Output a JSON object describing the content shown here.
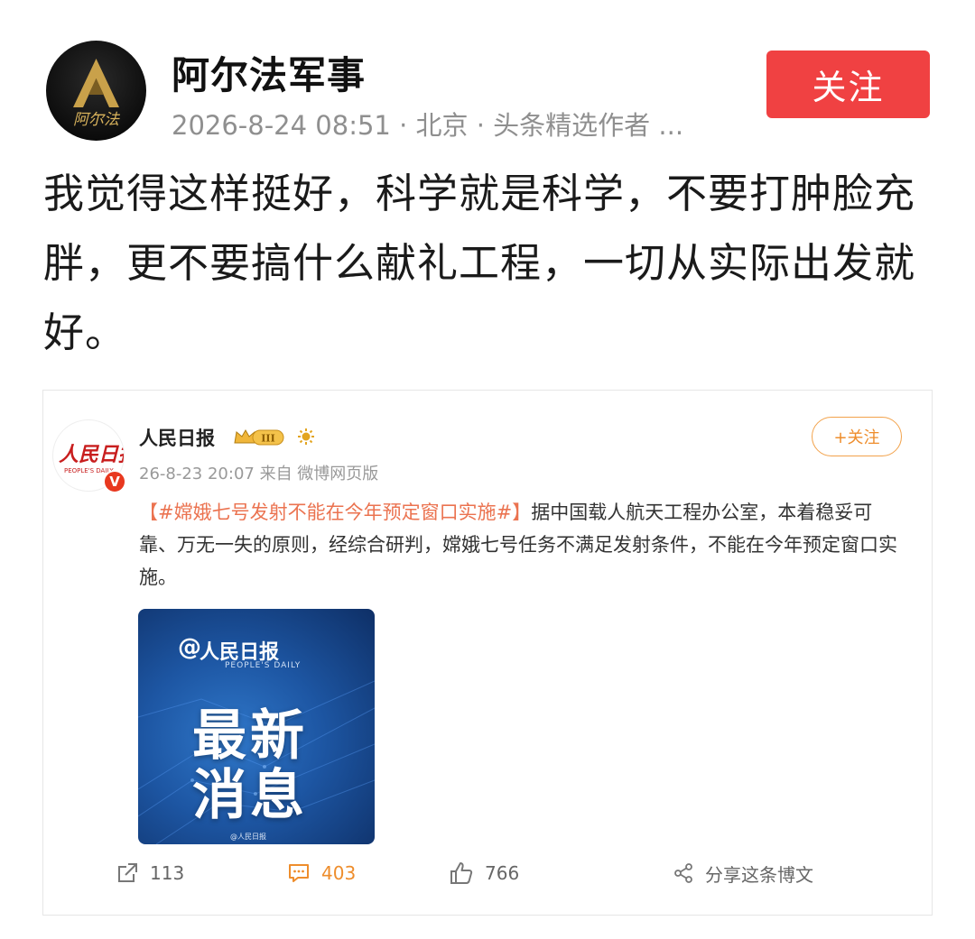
{
  "author": {
    "name": "阿尔法军事",
    "avatar_text": "阿尔法",
    "meta": "2026-8-24 08:51 · 北京 · 头条精选作者 ..."
  },
  "follow_label": "关注",
  "post": {
    "text": "我觉得这样挺好，科学就是科学，不要打肿脸充胖，更不要搞什么献礼工程，一切从实际出发就好。"
  },
  "embedded": {
    "avatar_logo": "人民日报",
    "avatar_logo_sub": "PEOPLE'S DAILY",
    "verified_badge": "V",
    "name": "人民日报",
    "level_badge": "III",
    "meta": "26-8-23 20:07 来自 微博网页版",
    "follow_label": "+关注",
    "topic": "【#嫦娥七号发射不能在今年预定窗口实施#】",
    "body": "据中国载人航天工程办公室，本着稳妥可靠、万无一失的原则，经综合研判，嫦娥七号任务不满足发射条件，不能在今年预定窗口实施。",
    "image": {
      "brand_at": "@",
      "brand": "人民日报",
      "brand_sub": "PEOPLE'S DAILY",
      "line1": "最新",
      "line2": "消息",
      "watermark": "@人民日报"
    },
    "actions": {
      "share_count": "113",
      "comment_count": "403",
      "like_count": "766",
      "share_post_label": "分享这条博文"
    }
  },
  "colors": {
    "follow_red": "#f04142",
    "topic_orange": "#eb7350",
    "weibo_orange": "#ee8d2c",
    "news_blue": "#1d56a3"
  }
}
